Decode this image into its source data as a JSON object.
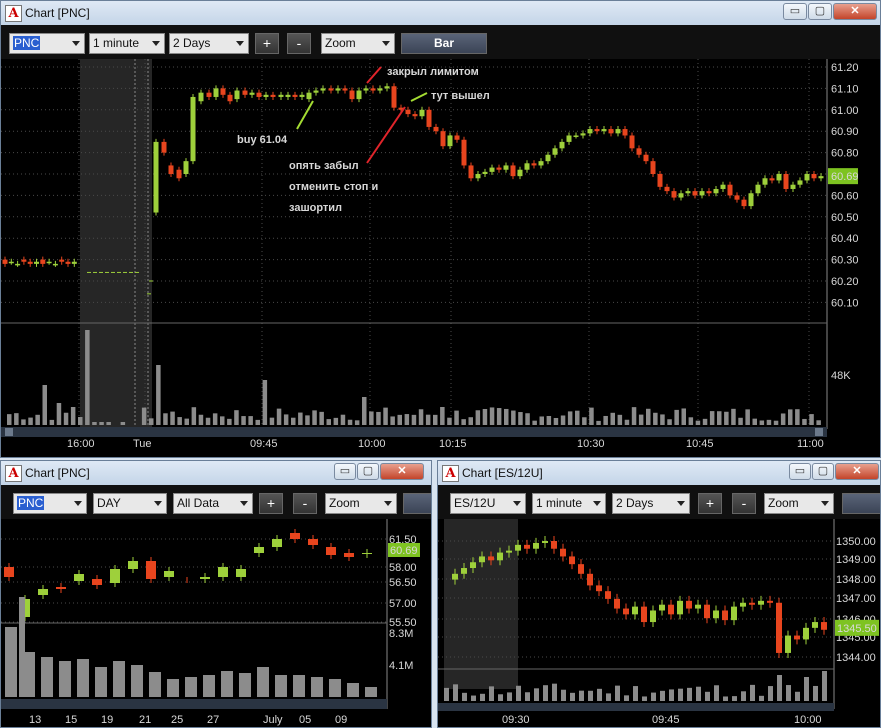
{
  "colors": {
    "up": "#9ed03b",
    "down": "#e8451e",
    "bg": "#000000",
    "grid": "#4a4a4a",
    "vol": "#8c8c8c",
    "shade": "#262626",
    "annot_red": "#e0242a",
    "annot_green": "#a4dc32",
    "last_bg": "#7ec321"
  },
  "icons": {
    "app": "app-logo-icon",
    "minimize": "minimize-icon",
    "restore": "restore-icon",
    "close": "close-icon",
    "dropdown": "chevron-down-icon"
  },
  "main": {
    "title": "Chart [PNC]",
    "app_letter": "A",
    "win_buttons": {
      "min": "▭",
      "max": "▢",
      "close": "✕"
    },
    "toolbar": {
      "symbol": "PNC",
      "interval": "1 minute",
      "range": "2 Days",
      "plus": "+",
      "minus": "-",
      "zoom": "Zoom",
      "bar": "Bar"
    },
    "price_labels": [
      "61.20",
      "61.10",
      "61.00",
      "60.90",
      "60.80",
      "60.70",
      "60.60",
      "60.50",
      "60.40",
      "60.30",
      "60.20",
      "60.10"
    ],
    "last_price": "60.69",
    "volume_label": "48K",
    "time_labels": [
      "16:00",
      "Tue",
      "09:45",
      "10:00",
      "10:15",
      "10:30",
      "10:45",
      "11:00"
    ],
    "annotations": {
      "buy": "buy 61.04",
      "closed": "закрыл лимитом",
      "exit": "тут вышел",
      "forgot": [
        "опять забыл",
        "отменить стоп и",
        "зашортил"
      ]
    }
  },
  "bl": {
    "title": "Chart [PNC]",
    "app_letter": "A",
    "win_buttons": {
      "min": "▭",
      "max": "▢",
      "close": "✕"
    },
    "toolbar": {
      "symbol": "PNC",
      "interval": "DAY",
      "range": "All Data",
      "plus": "+",
      "minus": "-",
      "zoom": "Zoom"
    },
    "price_labels": [
      "61.50",
      "58.00",
      "56.50",
      "57.00",
      "55.50"
    ],
    "last_price": "60.69",
    "volume_labels": [
      "8.3M",
      "4.1M"
    ],
    "time_labels": [
      "13",
      "15",
      "19",
      "21",
      "25",
      "27",
      "July",
      "05",
      "09"
    ]
  },
  "br": {
    "title": "Chart [ES/12U]",
    "app_letter": "A",
    "win_buttons": {
      "min": "▭",
      "max": "▢",
      "close": "✕"
    },
    "toolbar": {
      "symbol": "ES/12U",
      "interval": "1 minute",
      "range": "2 Days",
      "plus": "+",
      "minus": "-",
      "zoom": "Zoom"
    },
    "price_labels": [
      "1350.00",
      "1349.00",
      "1348.00",
      "1347.00",
      "1346.00",
      "1345.00",
      "1344.00"
    ],
    "last_price": "1345.50",
    "time_labels": [
      "09:30",
      "09:45",
      "10:00"
    ]
  }
}
